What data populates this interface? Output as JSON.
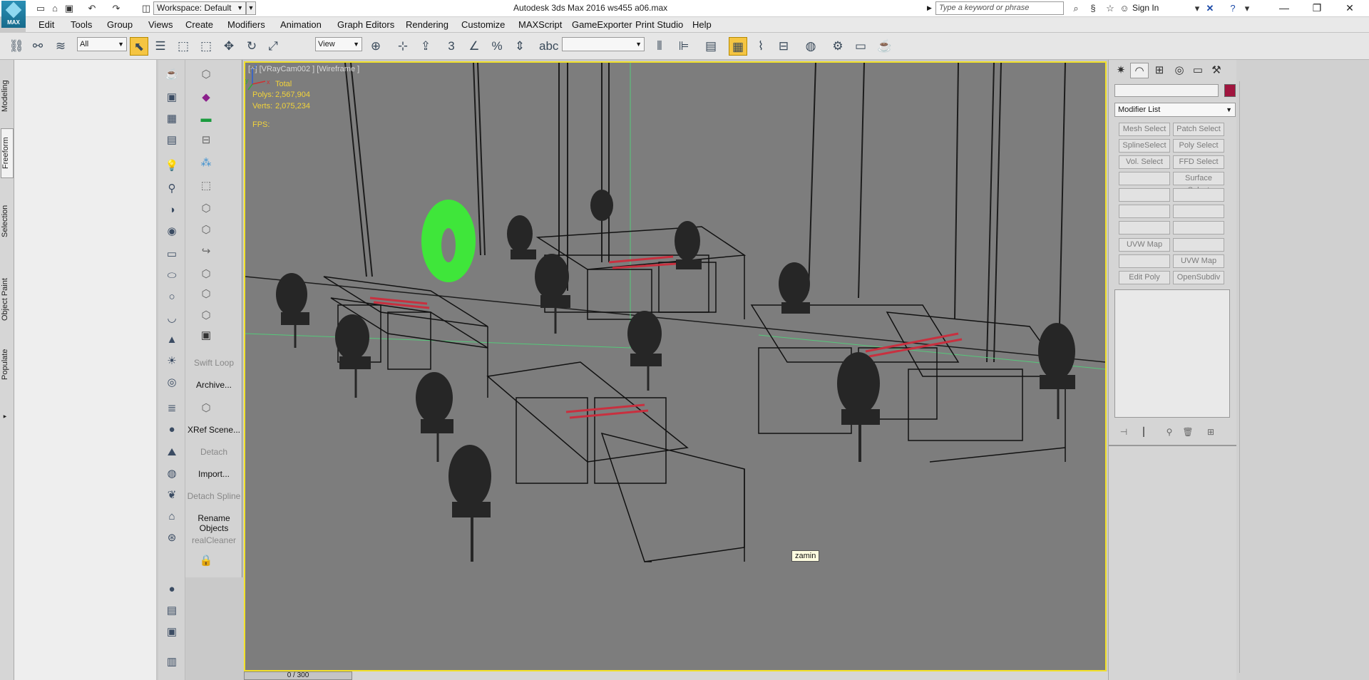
{
  "titlebar": {
    "logo_text": "MAX",
    "workspace": "Workspace: Default",
    "title": "Autodesk 3ds Max 2016      ws455 a06.max",
    "search_placeholder": "Type a keyword or phrase",
    "sign_in": "Sign In"
  },
  "menu": [
    "Edit",
    "Tools",
    "Group",
    "Views",
    "Create",
    "Modifiers",
    "Animation",
    "Graph Editors",
    "Rendering",
    "Customize",
    "MAXScript",
    "GameExporter",
    "Print Studio",
    "Help"
  ],
  "toolbar": {
    "selection_filter": "All",
    "reference_coord": "View",
    "named_selection": ""
  },
  "ribbon_tabs": [
    "Modeling",
    "Freeform",
    "Selection",
    "Object Paint",
    "Populate"
  ],
  "side_panel": {
    "labels": [
      "Swift Loop",
      "Archive...",
      "XRef Scene...",
      "Detach",
      "Import...",
      "Detach Spline",
      "Rename Objects",
      "realCleaner"
    ]
  },
  "viewport": {
    "label": "[+] [VRayCam002 ] [Wireframe ]",
    "stats_header": "Total",
    "polys_label": "Polys:",
    "polys_value": "2,567,904",
    "verts_label": "Verts:",
    "verts_value": "2,075,234",
    "fps_label": "FPS:",
    "tooltip": "zamin",
    "axis": {
      "x": "x",
      "y": "y",
      "z": "z"
    }
  },
  "timeline": {
    "frame": "0 / 300"
  },
  "command_panel": {
    "modifier_list": "Modifier List",
    "modifier_buttons": [
      [
        "Mesh Select",
        "Patch Select"
      ],
      [
        "SplineSelect",
        "Poly Select"
      ],
      [
        "Vol. Select",
        "FFD Select"
      ],
      [
        "",
        "Surface Select"
      ],
      [
        "",
        ""
      ],
      [
        "",
        ""
      ],
      [
        "",
        ""
      ],
      [
        "UVW Map",
        ""
      ],
      [
        "",
        "UVW Map"
      ],
      [
        "Edit Poly",
        "OpenSubdiv"
      ]
    ],
    "swatch_color": "#a0153e"
  },
  "colors": {
    "viewport_border": "#f2e12a",
    "viewport_bg": "#7d7d7d",
    "stats_text": "#f2d33a",
    "selection_green": "#3fe63a"
  }
}
